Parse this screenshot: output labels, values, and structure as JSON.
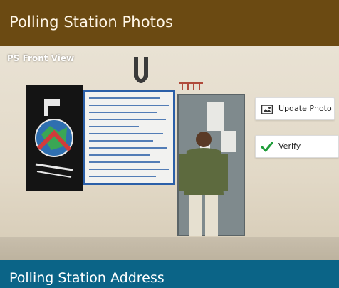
{
  "header": {
    "title": "Polling Station Photos",
    "color": "#6b4a12"
  },
  "photo": {
    "label": "PS Front View"
  },
  "actions": {
    "update_photo_label": "Update Photo",
    "verify_label": "Verify",
    "verify_icon_color": "#1f9d3a"
  },
  "footer": {
    "title": "Polling Station Address",
    "color": "#0b6487"
  }
}
